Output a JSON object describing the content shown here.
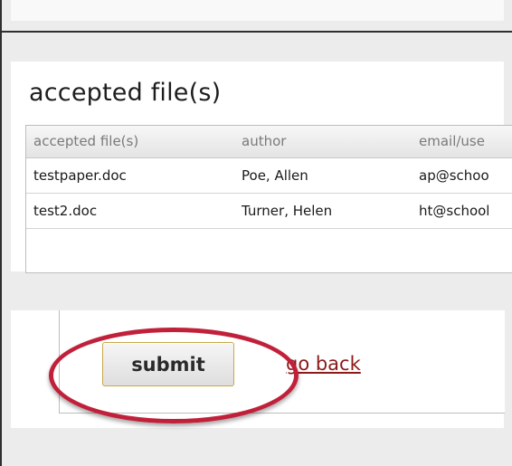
{
  "section": {
    "title": "accepted file(s)"
  },
  "table": {
    "columns": [
      "accepted file(s)",
      "author",
      "email/use"
    ],
    "rows": [
      [
        "testpaper.doc",
        "Poe, Allen",
        "ap@schoo"
      ],
      [
        "test2.doc",
        "Turner, Helen",
        "ht@school"
      ]
    ]
  },
  "actions": {
    "submit_label": "submit",
    "go_back_label": "go back"
  },
  "colors": {
    "highlight": "#c1203a",
    "link": "#8b1a1a",
    "button_border": "#c9a84a"
  }
}
